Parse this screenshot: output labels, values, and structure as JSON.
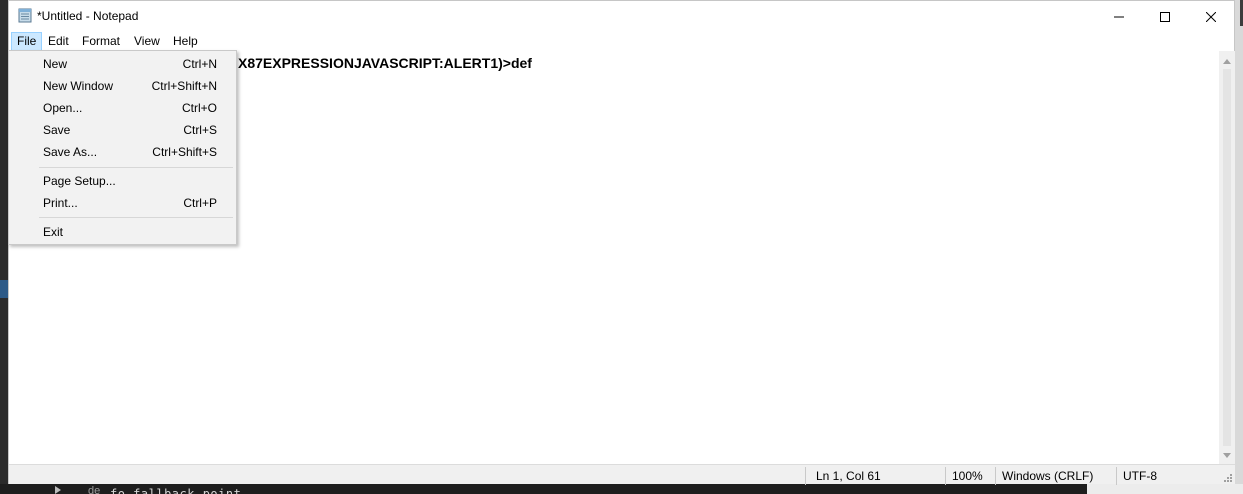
{
  "window": {
    "title": "*Untitled - Notepad",
    "controls": {
      "minimize": "minimize-icon",
      "maximize": "maximize-icon",
      "close": "close-icon"
    }
  },
  "menubar": {
    "items": [
      "File",
      "Edit",
      "Format",
      "View",
      "Help"
    ],
    "active": "File"
  },
  "editor": {
    "visible_text": "X87EXPRESSIONJAVASCRIPT:ALERT1)>def"
  },
  "file_menu": {
    "items": [
      {
        "label": "New",
        "shortcut": "Ctrl+N"
      },
      {
        "label": "New Window",
        "shortcut": "Ctrl+Shift+N"
      },
      {
        "label": "Open...",
        "shortcut": "Ctrl+O"
      },
      {
        "label": "Save",
        "shortcut": "Ctrl+S"
      },
      {
        "label": "Save As...",
        "shortcut": "Ctrl+Shift+S"
      },
      {
        "label": "Page Setup...",
        "shortcut": ""
      },
      {
        "label": "Print...",
        "shortcut": "Ctrl+P"
      },
      {
        "label": "Exit",
        "shortcut": ""
      }
    ]
  },
  "statusbar": {
    "position": "Ln 1, Col 61",
    "zoom": "100%",
    "line_ending": "Windows (CRLF)",
    "encoding": "UTF-8"
  },
  "background": {
    "bottom_label": "de",
    "bottom_text": "fo fallback point"
  },
  "colors": {
    "menu_highlight": "#cce8ff",
    "menu_highlight_border": "#99d1ff",
    "menu_bg": "#f2f2f2",
    "statusbar_bg": "#f0f0f0"
  }
}
